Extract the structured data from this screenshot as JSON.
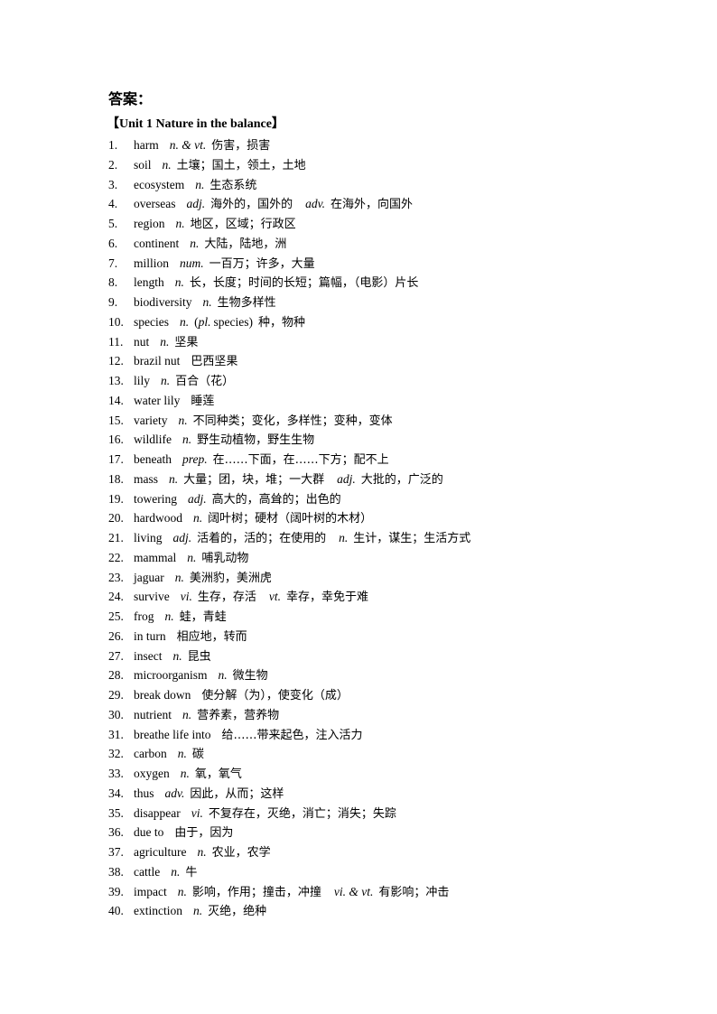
{
  "heading": "答案：",
  "unit_title": "【Unit 1 Nature in the balance】",
  "entries": [
    {
      "num": "1.",
      "word": "harm",
      "segments": [
        {
          "pos": "n. & vt.",
          "cn": "伤害，损害"
        }
      ]
    },
    {
      "num": "2.",
      "word": "soil",
      "segments": [
        {
          "pos": "n.",
          "cn": "土壤；国土，领土，土地"
        }
      ]
    },
    {
      "num": "3.",
      "word": "ecosystem",
      "segments": [
        {
          "pos": "n.",
          "cn": "生态系统"
        }
      ]
    },
    {
      "num": "4.",
      "word": "overseas",
      "segments": [
        {
          "pos": "adj.",
          "cn": "海外的，国外的"
        },
        {
          "pos": "adv.",
          "cn": "在海外，向国外"
        }
      ]
    },
    {
      "num": "5.",
      "word": "region",
      "segments": [
        {
          "pos": "n.",
          "cn": "地区，区域；行政区"
        }
      ]
    },
    {
      "num": "6.",
      "word": "continent",
      "segments": [
        {
          "pos": "n.",
          "cn": "大陆，陆地，洲"
        }
      ]
    },
    {
      "num": "7.",
      "word": "million",
      "segments": [
        {
          "pos": "num.",
          "cn": "一百万；许多，大量"
        }
      ]
    },
    {
      "num": "8.",
      "word": "length",
      "segments": [
        {
          "pos": "n.",
          "cn": "长，长度；时间的长短；篇幅，（电影）片长"
        }
      ]
    },
    {
      "num": "9.",
      "word": "biodiversity",
      "segments": [
        {
          "pos": "n.",
          "cn": "生物多样性"
        }
      ]
    },
    {
      "num": "10.",
      "word": "species",
      "segments": [
        {
          "pos": "n.",
          "extra_italic": "pl.",
          "extra_plain": "species",
          "cn": "种，物种"
        }
      ]
    },
    {
      "num": "11.",
      "word": "nut",
      "segments": [
        {
          "pos": "n.",
          "cn": "坚果"
        }
      ]
    },
    {
      "num": "12.",
      "word": "brazil nut",
      "segments": [
        {
          "pos": "",
          "cn": "巴西坚果"
        }
      ]
    },
    {
      "num": "13.",
      "word": "lily",
      "segments": [
        {
          "pos": "n.",
          "cn": "百合（花）"
        }
      ]
    },
    {
      "num": "14.",
      "word": "water lily",
      "segments": [
        {
          "pos": "",
          "cn": "睡莲"
        }
      ]
    },
    {
      "num": "15.",
      "word": "variety",
      "segments": [
        {
          "pos": "n.",
          "cn": "不同种类；变化，多样性；变种，变体"
        }
      ]
    },
    {
      "num": "16.",
      "word": "wildlife",
      "segments": [
        {
          "pos": "n.",
          "cn": "野生动植物，野生生物"
        }
      ]
    },
    {
      "num": "17.",
      "word": "beneath",
      "segments": [
        {
          "pos": "prep.",
          "cn": "在……下面，在……下方；配不上"
        }
      ]
    },
    {
      "num": "18.",
      "word": "mass",
      "segments": [
        {
          "pos": "n.",
          "cn": "大量；团，块，堆；一大群"
        },
        {
          "pos": "adj.",
          "cn": "大批的，广泛的"
        }
      ]
    },
    {
      "num": "19.",
      "word": "towering",
      "segments": [
        {
          "pos": "adj.",
          "cn": "高大的，高耸的；出色的"
        }
      ]
    },
    {
      "num": "20.",
      "word": "hardwood",
      "segments": [
        {
          "pos": "n.",
          "cn": "阔叶树；硬材（阔叶树的木材）"
        }
      ]
    },
    {
      "num": "21.",
      "word": "living",
      "segments": [
        {
          "pos": "adj.",
          "cn": "活着的，活的；在使用的"
        },
        {
          "pos": "n.",
          "cn": "生计，谋生；生活方式"
        }
      ]
    },
    {
      "num": "22.",
      "word": "mammal",
      "segments": [
        {
          "pos": "n.",
          "cn": "哺乳动物"
        }
      ]
    },
    {
      "num": "23.",
      "word": "jaguar",
      "segments": [
        {
          "pos": "n.",
          "cn": "美洲豹，美洲虎"
        }
      ]
    },
    {
      "num": "24.",
      "word": "survive",
      "segments": [
        {
          "pos": "vi.",
          "cn": "生存，存活"
        },
        {
          "pos": "vt.",
          "cn": "幸存，幸免于难"
        }
      ]
    },
    {
      "num": "25.",
      "word": "frog",
      "segments": [
        {
          "pos": "n.",
          "cn": "蛙，青蛙"
        }
      ]
    },
    {
      "num": "26.",
      "word": "in turn",
      "segments": [
        {
          "pos": "",
          "cn": "相应地，转而"
        }
      ]
    },
    {
      "num": "27.",
      "word": "insect",
      "segments": [
        {
          "pos": "n.",
          "cn": "昆虫"
        }
      ]
    },
    {
      "num": "28.",
      "word": "microorganism",
      "segments": [
        {
          "pos": "n.",
          "cn": "微生物"
        }
      ]
    },
    {
      "num": "29.",
      "word": "break down",
      "segments": [
        {
          "pos": "",
          "cn": "使分解（为），使变化（成）"
        }
      ]
    },
    {
      "num": "30.",
      "word": "nutrient",
      "segments": [
        {
          "pos": "n.",
          "cn": "营养素，营养物"
        }
      ]
    },
    {
      "num": "31.",
      "word": "breathe life into",
      "segments": [
        {
          "pos": "",
          "cn": "给……带来起色，注入活力"
        }
      ]
    },
    {
      "num": "32.",
      "word": "carbon",
      "segments": [
        {
          "pos": "n.",
          "cn": "碳"
        }
      ]
    },
    {
      "num": "33.",
      "word": "oxygen",
      "segments": [
        {
          "pos": "n.",
          "cn": "氧，氧气"
        }
      ]
    },
    {
      "num": "34.",
      "word": "thus",
      "segments": [
        {
          "pos": "adv.",
          "cn": "因此，从而；这样"
        }
      ]
    },
    {
      "num": "35.",
      "word": "disappear",
      "segments": [
        {
          "pos": "vi.",
          "cn": "不复存在，灭绝，消亡；消失；失踪"
        }
      ]
    },
    {
      "num": "36.",
      "word": "due to",
      "segments": [
        {
          "pos": "",
          "cn": "由于，因为"
        }
      ]
    },
    {
      "num": "37.",
      "word": "agriculture",
      "segments": [
        {
          "pos": "n.",
          "cn": "农业，农学"
        }
      ]
    },
    {
      "num": "38.",
      "word": "cattle",
      "segments": [
        {
          "pos": "n.",
          "cn": "牛"
        }
      ]
    },
    {
      "num": "39.",
      "word": "impact",
      "segments": [
        {
          "pos": "n.",
          "cn": "影响，作用；撞击，冲撞"
        },
        {
          "pos": "vi. & vt.",
          "cn": "有影响；冲击"
        }
      ]
    },
    {
      "num": "40.",
      "word": "extinction",
      "segments": [
        {
          "pos": "n.",
          "cn": "灭绝，绝种"
        }
      ]
    }
  ]
}
